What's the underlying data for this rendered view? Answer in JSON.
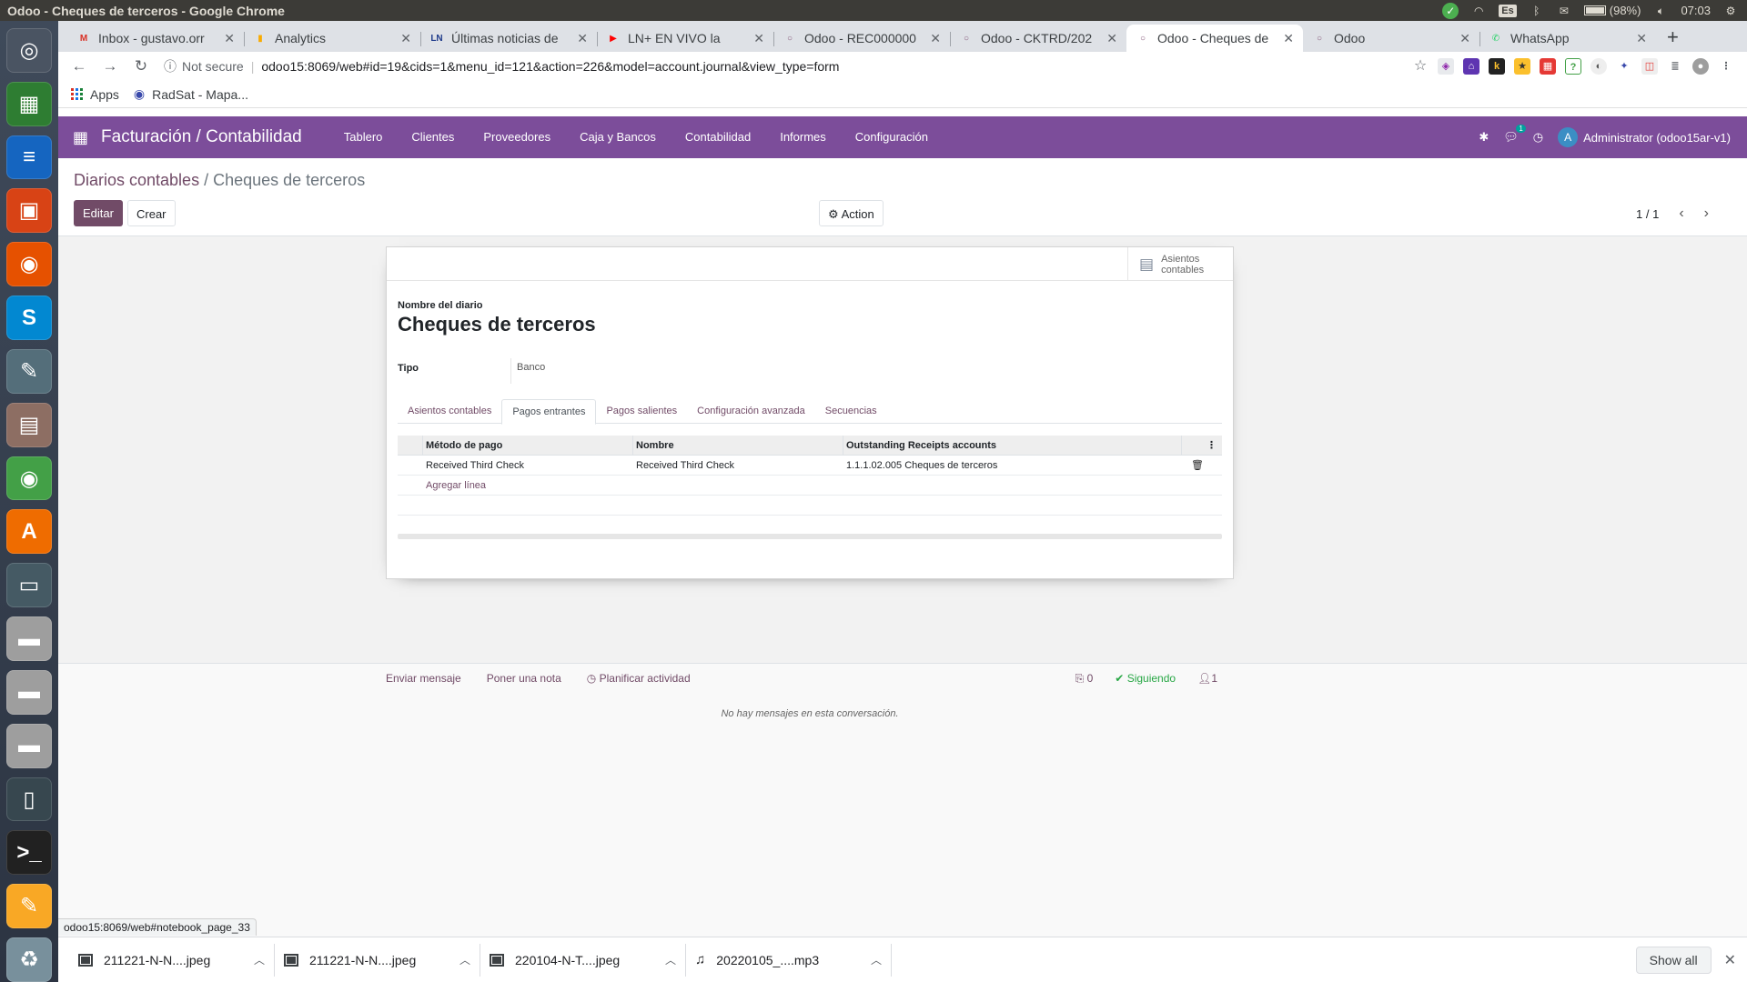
{
  "os": {
    "window_title": "Odoo - Cheques de terceros - Google Chrome",
    "kbd_layout": "Es",
    "battery": "(98%)",
    "clock": "07:03"
  },
  "chrome": {
    "tabs": [
      {
        "label": "Inbox - gustavo.orr",
        "fav_color": "#d93025",
        "fav": "M"
      },
      {
        "label": "Analytics",
        "fav_color": "#f9ab00",
        "fav": "▮"
      },
      {
        "label": "Últimas noticias de",
        "fav_color": "#1e3a8a",
        "fav": "LN"
      },
      {
        "label": "LN+ EN VIVO la",
        "fav_color": "#ff0000",
        "fav": "▶"
      },
      {
        "label": "Odoo - REC000000",
        "fav_color": "#875a7b",
        "fav": "○"
      },
      {
        "label": "Odoo - CKTRD/202",
        "fav_color": "#875a7b",
        "fav": "○"
      },
      {
        "label": "Odoo - Cheques de",
        "fav_color": "#875a7b",
        "fav": "○",
        "active": true
      },
      {
        "label": "Odoo",
        "fav_color": "#875a7b",
        "fav": "○"
      },
      {
        "label": "WhatsApp",
        "fav_color": "#25d366",
        "fav": "✆"
      }
    ],
    "security": "Not secure",
    "url": "odoo15:8069/web#id=19&cids=1&menu_id=121&action=226&model=account.journal&view_type=form",
    "bookmarks": {
      "apps": "Apps",
      "radsat": "RadSat - Mapa..."
    },
    "status_url": "odoo15:8069/web#notebook_page_33"
  },
  "odoo": {
    "app_title": "Facturación / Contabilidad",
    "menu": [
      "Tablero",
      "Clientes",
      "Proveedores",
      "Caja y Bancos",
      "Contabilidad",
      "Informes",
      "Configuración"
    ],
    "chat_badge": "1",
    "user": "Administrator (odoo15ar-v1)",
    "user_initial": "A",
    "breadcrumb_parent": "Diarios contables",
    "breadcrumb_sep": " / ",
    "breadcrumb_current": "Cheques de terceros",
    "btn_edit": "Editar",
    "btn_create": "Crear",
    "btn_action": "Action",
    "pager": "1 / 1",
    "stat_button": "Asientos contables",
    "name_label": "Nombre del diario",
    "journal_name": "Cheques de terceros",
    "tipo_label": "Tipo",
    "tipo_value": "Banco",
    "notebook_tabs": [
      "Asientos contables",
      "Pagos entrantes",
      "Pagos salientes",
      "Configuración avanzada",
      "Secuencias"
    ],
    "active_tab": 1,
    "table": {
      "headers": [
        "Método de pago",
        "Nombre",
        "Outstanding Receipts accounts"
      ],
      "rows": [
        [
          "Received Third Check",
          "Received Third Check",
          "1.1.1.02.005 Cheques de terceros"
        ]
      ],
      "add_line": "Agregar línea"
    },
    "chatter": {
      "send_message": "Enviar mensaje",
      "log_note": "Poner una nota",
      "schedule": "Planificar actividad",
      "attachments": "0",
      "following": "Siguiendo",
      "followers": "1",
      "empty": "No hay mensajes en esta conversación."
    }
  },
  "downloads": [
    {
      "name": "211221-N-N....jpeg"
    },
    {
      "name": "211221-N-N....jpeg"
    },
    {
      "name": "220104-N-T....jpeg"
    },
    {
      "name": "20220105_....mp3"
    }
  ],
  "show_all": "Show all"
}
